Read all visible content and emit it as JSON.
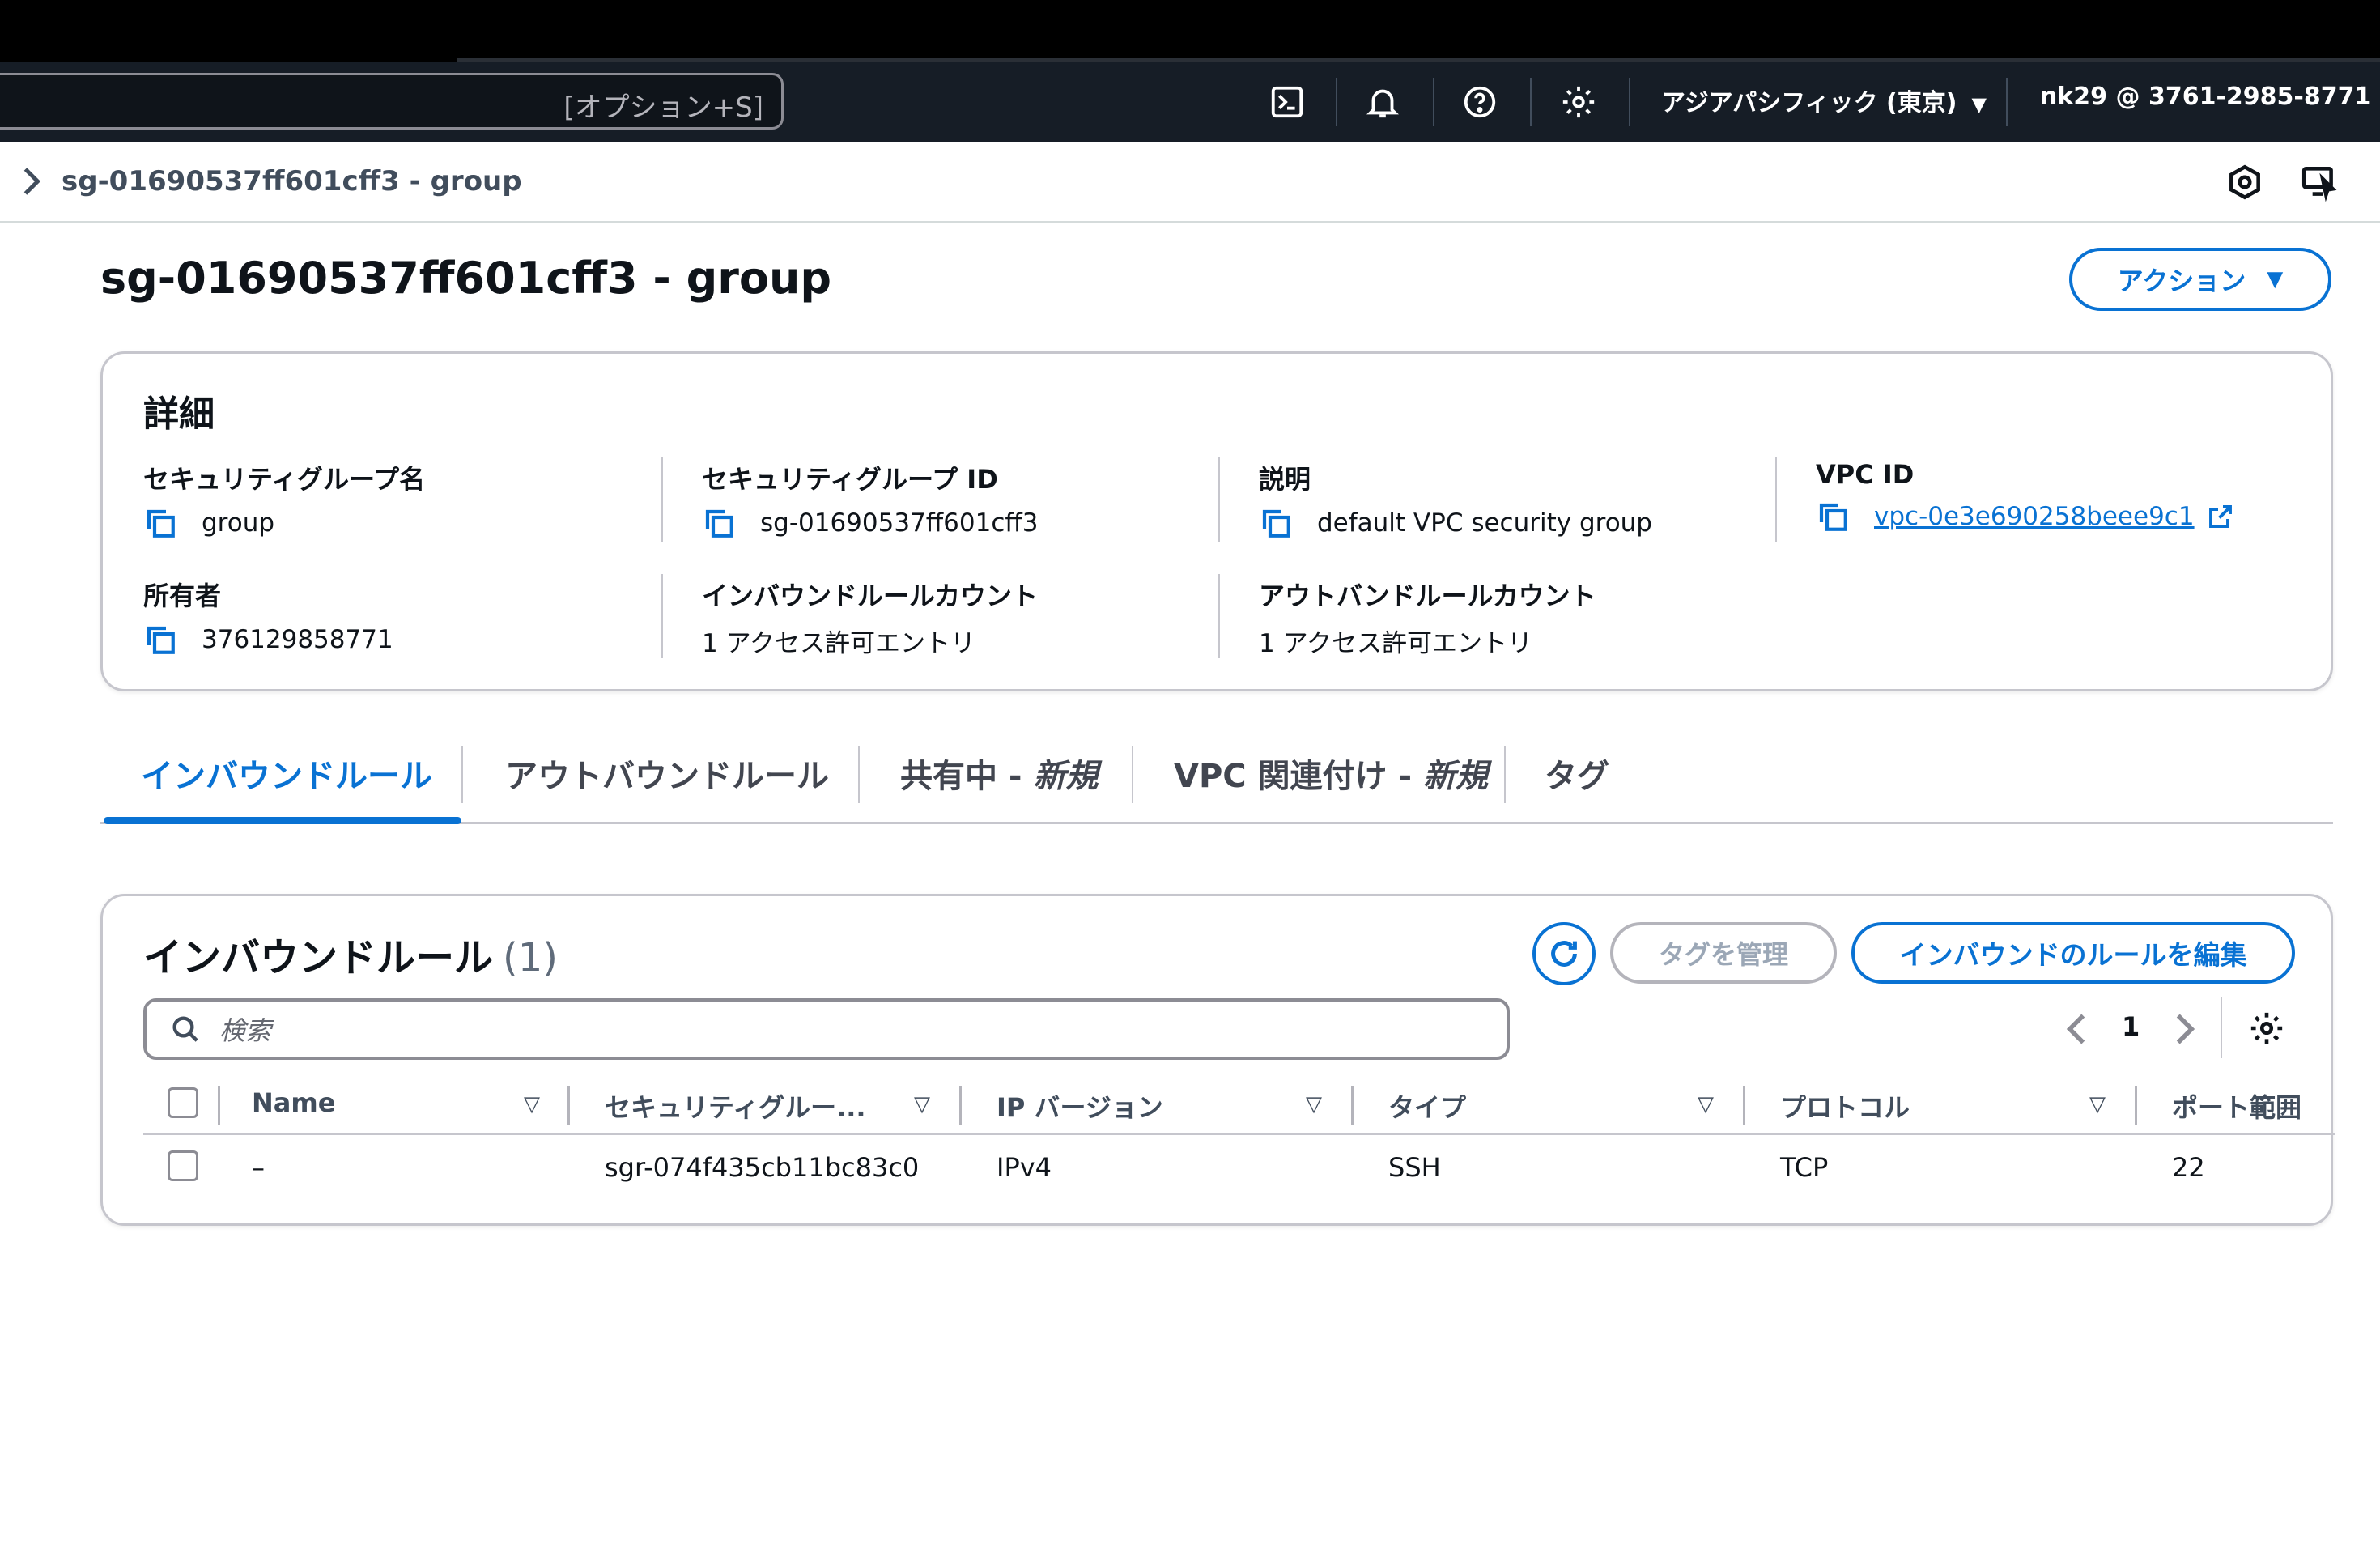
{
  "navbar": {
    "search_shortcut": "[オプション+S]",
    "region": "アジアパシフィック (東京)",
    "account": "nk29 @ 3761-2985-8771",
    "icons": [
      "cloudshell-icon",
      "bell-icon",
      "help-icon",
      "gear-icon"
    ]
  },
  "breadcrumb": {
    "current": "sg-01690537ff601cff3 - group"
  },
  "header": {
    "title": "sg-01690537ff601cff3 - group",
    "actions_label": "アクション"
  },
  "details": {
    "title": "詳細",
    "sg_name_label": "セキュリティグループ名",
    "sg_name_value": "group",
    "sg_id_label": "セキュリティグループ ID",
    "sg_id_value": "sg-01690537ff601cff3",
    "description_label": "説明",
    "description_value": "default VPC security group",
    "vpc_id_label": "VPC ID",
    "vpc_id_value": "vpc-0e3e690258beee9c1",
    "owner_label": "所有者",
    "owner_value": "376129858771",
    "inbound_count_label": "インバウンドルールカウント",
    "inbound_count_value": "1 アクセス許可エントリ",
    "outbound_count_label": "アウトバンドルールカウント",
    "outbound_count_value": "1 アクセス許可エントリ"
  },
  "tabs": [
    {
      "label": "インバウンドルール"
    },
    {
      "label": "アウトバウンドルール"
    },
    {
      "label": "共有中 - ",
      "badge": "新規"
    },
    {
      "label": "VPC 関連付け - ",
      "badge": "新規"
    },
    {
      "label": "タグ"
    }
  ],
  "rules": {
    "title": "インバウンドルール",
    "count": "(1)",
    "manage_tags_label": "タグを管理",
    "edit_label": "インバウンドのルールを編集",
    "search_placeholder": "検索",
    "page_number": "1",
    "columns": [
      "Name",
      "セキュリティグルー...",
      "IP バージョン",
      "タイプ",
      "プロトコル",
      "ポート範囲"
    ],
    "rows": [
      {
        "name": "–",
        "rule_id": "sgr-074f435cb11bc83c0",
        "ip_version": "IPv4",
        "type": "SSH",
        "protocol": "TCP",
        "port": "22"
      }
    ]
  },
  "colors": {
    "accent": "#0972d3",
    "navbar_bg": "#161d26",
    "border": "#c6c6cd"
  }
}
